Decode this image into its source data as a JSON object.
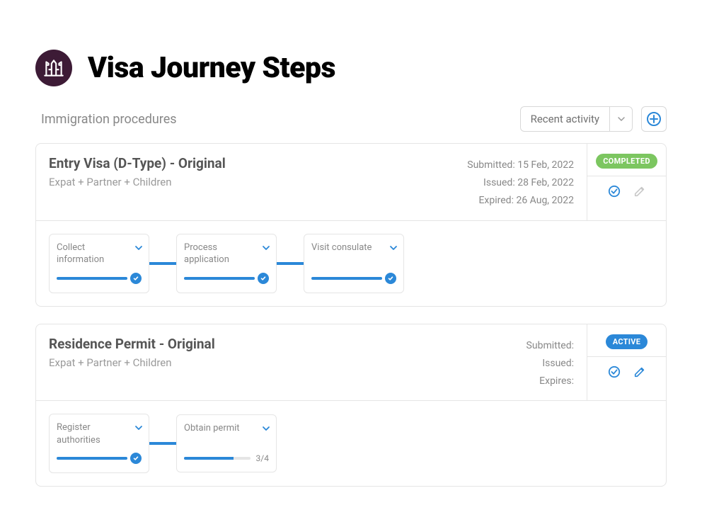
{
  "header": {
    "title": "Visa Journey Steps"
  },
  "subheader": {
    "subtitle": "Immigration procedures",
    "filter_label": "Recent activity"
  },
  "cards": [
    {
      "title": "Entry Visa (D-Type) - Original",
      "subtitle": "Expat + Partner + Children",
      "dates": [
        {
          "label": "Submitted:",
          "value": "15 Feb, 2022"
        },
        {
          "label": "Issued:",
          "value": "28 Feb, 2022"
        },
        {
          "label": "Expired:",
          "value": "26 Aug, 2022"
        }
      ],
      "status": "COMPLETED",
      "edit_enabled": false,
      "steps": [
        {
          "label": "Collect information",
          "fill": 100,
          "done": true
        },
        {
          "label": "Process application",
          "fill": 100,
          "done": true
        },
        {
          "label": "Visit consulate",
          "fill": 100,
          "done": true
        }
      ]
    },
    {
      "title": "Residence Permit - Original",
      "subtitle": "Expat + Partner + Children",
      "dates": [
        {
          "label": "Submitted:",
          "value": ""
        },
        {
          "label": "Issued:",
          "value": ""
        },
        {
          "label": "Expires:",
          "value": ""
        }
      ],
      "status": "ACTIVE",
      "edit_enabled": true,
      "steps": [
        {
          "label": "Register authorities",
          "fill": 100,
          "done": true
        },
        {
          "label": "Obtain permit",
          "fill": 75,
          "done": false,
          "progress_text": "3/4"
        }
      ]
    }
  ],
  "colors": {
    "accent": "#2b88d8",
    "completed": "#7cc660"
  }
}
